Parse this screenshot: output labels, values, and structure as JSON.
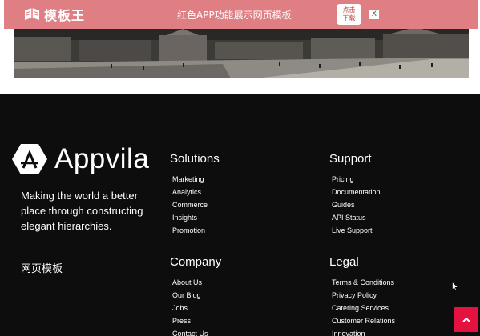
{
  "topbar": {
    "logo_text": "模板王",
    "title": "红色APP功能展示网页模板",
    "download_line1": "点击",
    "download_line2": "下载",
    "close_label": "X"
  },
  "footer": {
    "brand_name": "Appvila",
    "tagline": "Making the world a better place through constructing elegant hierarchies.",
    "cn_text": "网页模板",
    "solutions": {
      "heading": "Solutions",
      "items": [
        "Marketing",
        "Analytics",
        "Commerce",
        "Insights",
        "Promotion"
      ]
    },
    "support": {
      "heading": "Support",
      "items": [
        "Pricing",
        "Documentation",
        "Guides",
        "API Status",
        "Live Support"
      ]
    },
    "company": {
      "heading": "Company",
      "items": [
        "About Us",
        "Our Blog",
        "Jobs",
        "Press",
        "Contact Us"
      ]
    },
    "legal": {
      "heading": "Legal",
      "items": [
        "Terms & Conditions",
        "Privacy Policy",
        "Catering Services",
        "Customer Relations",
        "Innovation"
      ]
    }
  },
  "colors": {
    "topbar_bg": "#df7f84",
    "footer_bg": "#0d0d0d",
    "accent": "#e3123f"
  },
  "icons": {
    "logo_mark": "book-icon",
    "brand_logo": "hexagon-a-icon",
    "scroll_top": "chevron-up-icon",
    "cursor": "mouse-pointer-icon"
  }
}
